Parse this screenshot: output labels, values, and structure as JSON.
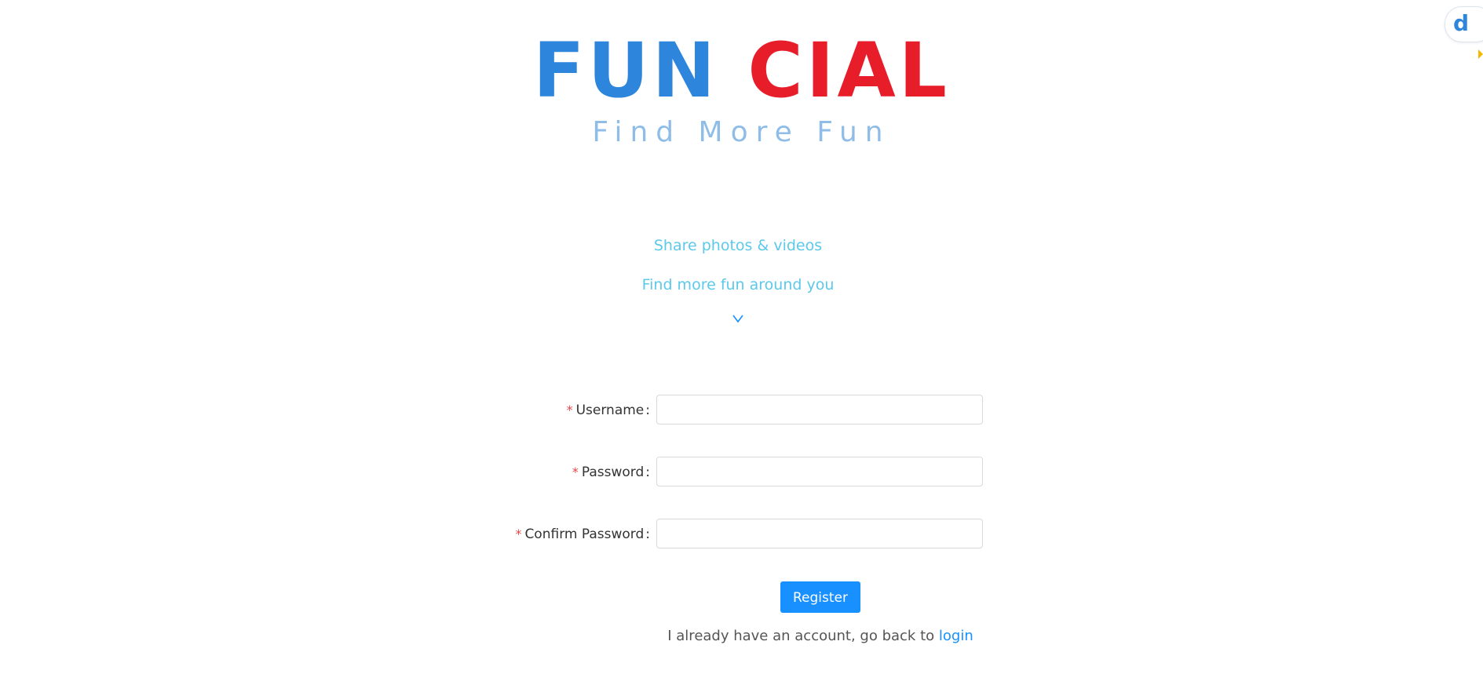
{
  "logo": {
    "part1": "FUN",
    "part2": "CIAL",
    "tagline": "Find More Fun"
  },
  "promo": {
    "line1": "Share photos & videos",
    "line2": "Find more fun around you",
    "scroll_icon": "chevron-down-icon"
  },
  "form": {
    "required_mark": "*",
    "colon": ":",
    "fields": [
      {
        "label": "Username",
        "value": "",
        "placeholder": ""
      },
      {
        "label": "Password",
        "value": "",
        "placeholder": ""
      },
      {
        "label": "Confirm Password",
        "value": "",
        "placeholder": ""
      }
    ],
    "submit_label": "Register"
  },
  "footer": {
    "back_text": "I already have an account, go back to ",
    "login_link": "login"
  },
  "widget": {
    "icon": "d",
    "icon_name": "assistant-logo-icon"
  },
  "colors": {
    "brand_blue": "#2d86dc",
    "brand_red": "#e81d2a",
    "tagline": "#8fbde8",
    "promo": "#5cc8ea",
    "primary_button": "#1890ff",
    "required": "#e5484d"
  }
}
